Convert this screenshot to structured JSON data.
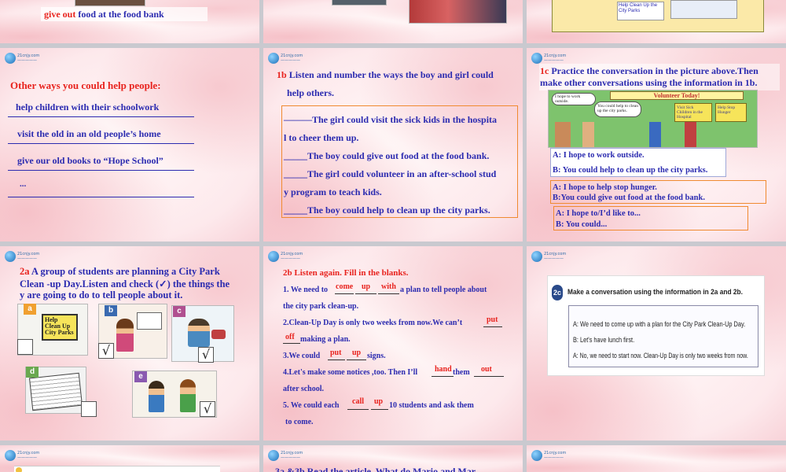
{
  "slide1": {
    "caption_verb": "give out",
    "caption_rest": " food at the food bank"
  },
  "slide4": {
    "title_lead": "Other ways you could ",
    "title_verb": "help",
    "title_rest": "  people:",
    "items": [
      "help children with their schoolwork",
      "visit the old in an old people’s home",
      "give our old books to “Hope School”",
      "..."
    ]
  },
  "slide5": {
    "heading_num": "1b",
    "heading_l1": " Listen and number the ways the boy and girl could",
    "heading_l2": "help others.",
    "lines": [
      "———The girl could visit  the sick kids in the hospita",
      "l to cheer them up.",
      "_____The boy could give out food  at the food bank.",
      "_____The girl could volunteer in an after-school stud",
      "y program to teach kids.",
      "_____The boy could help to clean up the city parks."
    ]
  },
  "slide6": {
    "heading_num": "1c",
    "heading_l1": " Practice the conversation in the picture above.Then",
    "heading_l2": "make other conversations using the information in 1b.",
    "poster": "Volunteer Today!",
    "bubble1": "I hope to work outside.",
    "bubble2": "You could help to clean up the city parks.",
    "sign": "Visit Sick Children in the Hospital",
    "sign2": "Help Stop Hunger",
    "d1": [
      "A: I hope to work outside.",
      "B: You could help to clean up the city parks."
    ],
    "d2": [
      "A: I hope to help stop hunger.",
      "B:You  could give out food at the food bank."
    ],
    "d3": [
      "A: I hope to/I’d like to...",
      "B: You could..."
    ]
  },
  "slide3top": {
    "sign": "Help Clean Up the City Parks"
  },
  "slide7": {
    "heading_num": "2a",
    "l1": "  A group  of students  are planning a City Park",
    "l2": "Clean -up Day.Listen and check (✓) the things the",
    "l3": "y are going to do to tell people about it.",
    "labels": [
      "a",
      "b",
      "c",
      "d",
      "e"
    ],
    "checks": [
      "",
      "√",
      "√",
      "",
      "√"
    ],
    "board": "Help Clean Up City Parks"
  },
  "slide8": {
    "heading_num": "2b",
    "heading_rest": " Listen again. Fill in the blanks.",
    "s1a": "1.  We need to",
    "s1b": " a plan to tell people about",
    "s1c": "the city park clean-up.",
    "s2a": "2.Clean-Up Day is only two weeks from now.We can’t",
    "s2b": "making a plan.",
    "s3a": "3.We could ",
    "s3b": "signs.",
    "s4a": "4.Let's make some notices ,too. Then I’ll",
    "s4b": " them",
    "s4c": "after   school.",
    "s5a": "5. We could each",
    "s5b": "10 students  and ask them",
    "s5c": "to come.",
    "ans": [
      "come",
      "up",
      "with",
      "put",
      "off",
      "put",
      "up",
      "hand",
      "out",
      "call",
      "up"
    ]
  },
  "slide9": {
    "badge": "2c",
    "heading": "Make a conversation using the information in 2a and 2b.",
    "lines": [
      "A: We need to come up with a plan for the City Park Clean-Up Day.",
      "B: Let's have lunch first.",
      "A: No, we need to start now. Clean-Up Day is only two weeks from now."
    ]
  },
  "slide11": {
    "heading": "3a &3b Read the article. What do Mario and Mar"
  }
}
